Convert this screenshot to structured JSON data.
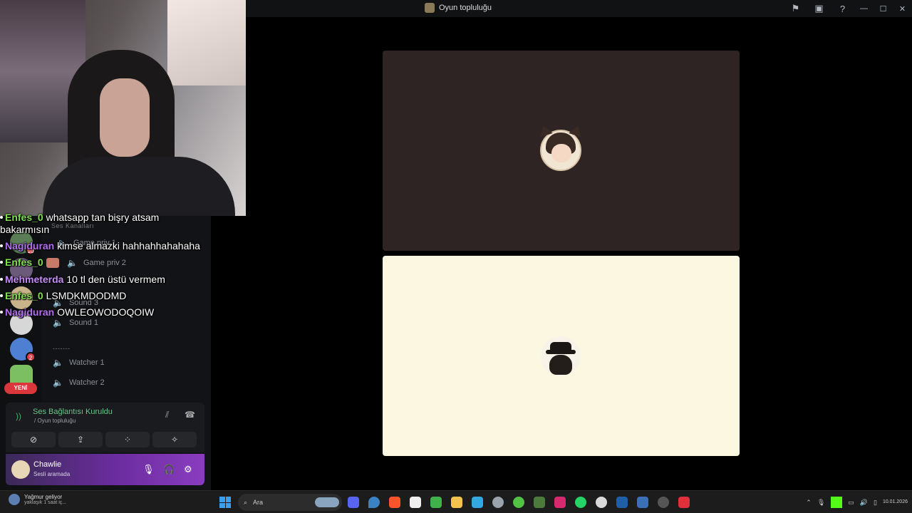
{
  "window": {
    "title": "Oyun topluluğu",
    "controls": [
      "flag-icon",
      "inbox-icon",
      "help-icon",
      "minimize-icon",
      "maximize-icon",
      "close-icon"
    ]
  },
  "chat_overlay": [
    {
      "nick": "Enfes_0",
      "nick_color": "#7ee050",
      "message": "whatsapp tan bişry atsam bakarmısın"
    },
    {
      "nick": "Nagiduran",
      "nick_color": "#b46ef2",
      "message": "kimse almazki hahhahhahahaha"
    },
    {
      "nick": "Enfes_0",
      "nick_color": "#7ee050",
      "message": ""
    },
    {
      "nick": "Mehmeterda",
      "nick_color": "#c58cf5",
      "message": "10 tl den üstü vermem"
    },
    {
      "nick": "Enfes_0",
      "nick_color": "#7ee050",
      "message": "LSMDKMDODMD"
    },
    {
      "nick": "Nagiduran",
      "nick_color": "#b46ef2",
      "message": "OWLEOWODOQOIW"
    }
  ],
  "channels": {
    "category_voice": "Ses Kanalları",
    "items": [
      {
        "label": "Game priv 1"
      },
      {
        "label": "Game priv 2"
      },
      {
        "label": "Sound 3"
      },
      {
        "label": "Sound 1"
      }
    ],
    "category_other": "-------",
    "watchers": [
      {
        "label": "Watcher 1"
      },
      {
        "label": "Watcher 2"
      }
    ]
  },
  "servers": {
    "new_badge": "YENİ",
    "badges": [
      "10",
      "2"
    ]
  },
  "voice_panel": {
    "status": "Ses Bağlantısı Kuruldu",
    "server": "/ Oyun topluluğu"
  },
  "user": {
    "name": "Chawlie",
    "status": "Sesli aramada"
  },
  "taskbar": {
    "weather_title": "Yağmur geliyor",
    "weather_sub": "yaklaşık 1 saat iç...",
    "search_placeholder": "Ara",
    "date": "10.01.2026"
  }
}
